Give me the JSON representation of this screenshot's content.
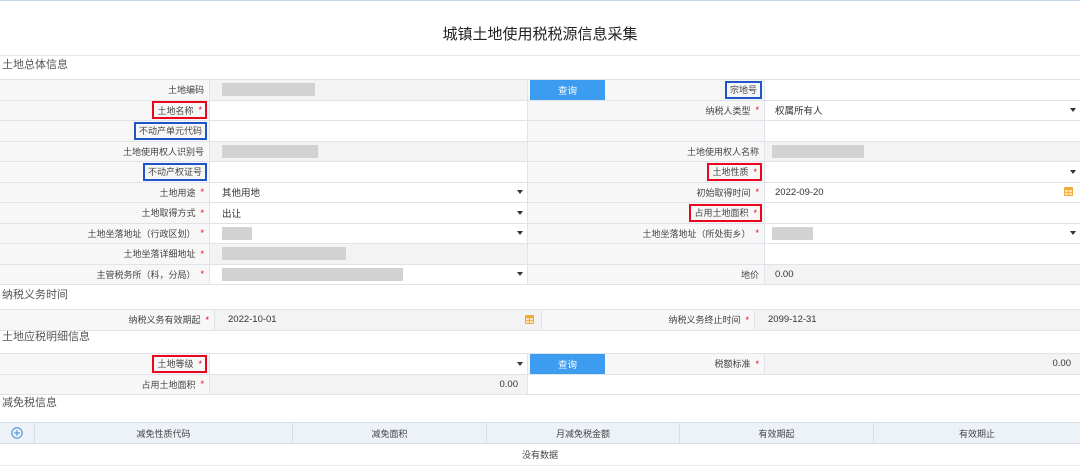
{
  "title": "城镇土地使用税税源信息采集",
  "required_mark": "*",
  "colors": {
    "accent": "#3c9df0",
    "highlight_red": "#e8071d",
    "highlight_blue": "#1f55c6",
    "required": "#e60012",
    "calendar": "#f0a83a"
  },
  "sections": {
    "general": "土地总体信息",
    "obligation": "纳税义务时间",
    "detail": "土地应税明细信息",
    "relief": "减免税信息"
  },
  "general": {
    "land_code": {
      "label": "土地编码"
    },
    "query_button": "查询",
    "parcel_no": {
      "label": "宗地号"
    },
    "land_name": {
      "label": "土地名称"
    },
    "taxpayer_type": {
      "label": "纳税人类型",
      "value": "权属所有人"
    },
    "property_unit_code": {
      "label": "不动产单元代码"
    },
    "user_id_no": {
      "label": "土地使用权人识别号"
    },
    "user_name": {
      "label": "土地使用权人名称"
    },
    "property_cert_no": {
      "label": "不动产权证号"
    },
    "land_nature": {
      "label": "土地性质"
    },
    "land_use": {
      "label": "土地用途",
      "value": "其他用地"
    },
    "initial_acquire_date": {
      "label": "初始取得时间",
      "value": "2022-09-20"
    },
    "acquire_method": {
      "label": "土地取得方式",
      "value": "出让"
    },
    "occupied_area": {
      "label": "占用土地面积"
    },
    "address_district": {
      "label": "土地坐落地址（行政区划）"
    },
    "address_street": {
      "label": "土地坐落地址（所处街乡）"
    },
    "address_detail": {
      "label": "土地坐落详细地址"
    },
    "tax_office": {
      "label": "主管税务所（科，分局）"
    },
    "land_price": {
      "label": "地价",
      "value": "0.00"
    }
  },
  "obligation": {
    "start": {
      "label": "纳税义务有效期起",
      "value": "2022-10-01"
    },
    "end": {
      "label": "纳税义务终止时间",
      "value": "2099-12-31"
    }
  },
  "detail": {
    "land_grade": {
      "label": "土地等级"
    },
    "query_button": "查询",
    "tax_standard": {
      "label": "税额标准",
      "value": "0.00"
    },
    "occupied_area": {
      "label": "占用土地面积",
      "value": "0.00"
    }
  },
  "relief": {
    "columns": [
      "减免性质代码",
      "减免面积",
      "月减免税金额",
      "有效期起",
      "有效期止"
    ],
    "empty_text": "没有数据"
  },
  "icons": {
    "add_row": "plus-circle-icon",
    "date_picker": "calendar-icon",
    "select": "chevron-down-icon"
  }
}
